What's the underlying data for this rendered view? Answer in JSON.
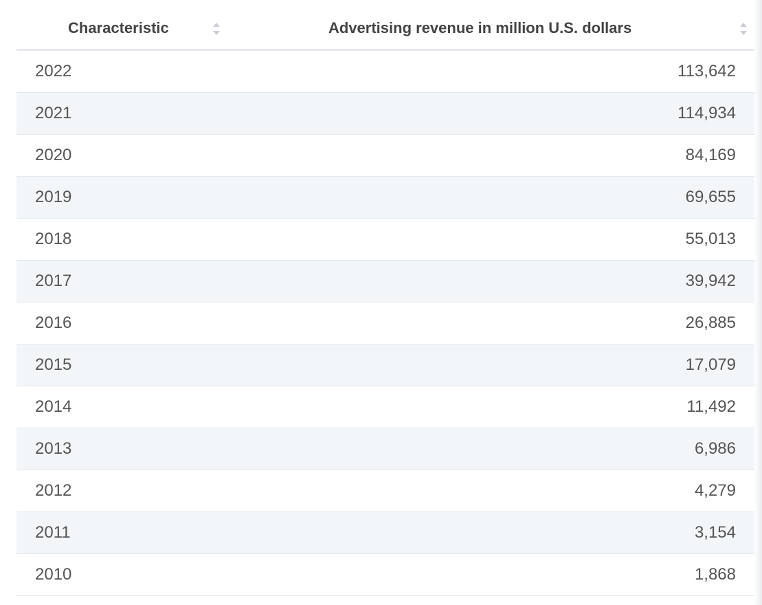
{
  "table": {
    "headers": {
      "characteristic": "Characteristic",
      "revenue": "Advertising revenue in million U.S. dollars"
    },
    "rows": [
      {
        "year": "2022",
        "value": "113,642"
      },
      {
        "year": "2021",
        "value": "114,934"
      },
      {
        "year": "2020",
        "value": "84,169"
      },
      {
        "year": "2019",
        "value": "69,655"
      },
      {
        "year": "2018",
        "value": "55,013"
      },
      {
        "year": "2017",
        "value": "39,942"
      },
      {
        "year": "2016",
        "value": "26,885"
      },
      {
        "year": "2015",
        "value": "17,079"
      },
      {
        "year": "2014",
        "value": "11,492"
      },
      {
        "year": "2013",
        "value": "6,986"
      },
      {
        "year": "2012",
        "value": "4,279"
      },
      {
        "year": "2011",
        "value": "3,154"
      },
      {
        "year": "2010",
        "value": "1,868"
      }
    ]
  },
  "icons": {
    "sort": "sort-updown-icon"
  },
  "colors": {
    "header_text": "#444444",
    "row_alt_bg": "#f3f6f9",
    "border": "#e3e6ea"
  },
  "chart_data": {
    "type": "table",
    "columns": [
      "Characteristic",
      "Advertising revenue in million U.S. dollars"
    ],
    "categories": [
      "2022",
      "2021",
      "2020",
      "2019",
      "2018",
      "2017",
      "2016",
      "2015",
      "2014",
      "2013",
      "2012",
      "2011",
      "2010"
    ],
    "values": [
      113642,
      114934,
      84169,
      69655,
      55013,
      39942,
      26885,
      17079,
      11492,
      6986,
      4279,
      3154,
      1868
    ]
  }
}
